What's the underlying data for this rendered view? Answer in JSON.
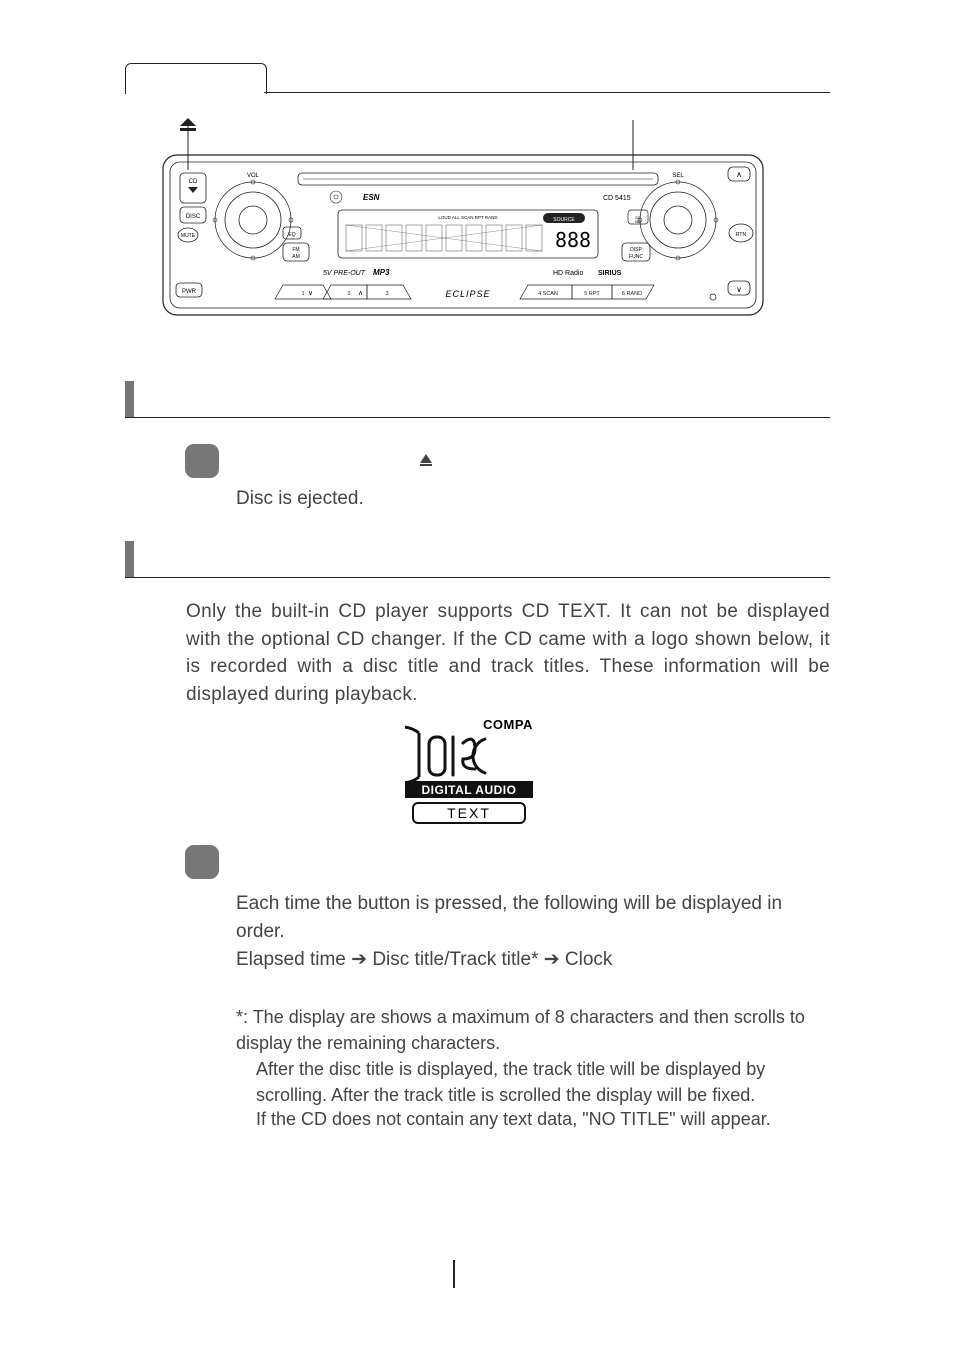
{
  "radio": {
    "model": "CD 5415",
    "brand": "ECLIPSE",
    "esn": "ESN",
    "labels": {
      "cd": "CD",
      "vol": "VOL",
      "sel": "SEL",
      "disc": "DISC",
      "mute": "MUTE",
      "sound": "SOUND",
      "rtn": "RTN",
      "fmam": "FM\nAM",
      "eq": "EQ",
      "disp_func": "DISP\nFUNC",
      "pwr": "PWR",
      "preout": "5V PRE-OUT",
      "mp3": "MP3",
      "hdradio": "HD Radio",
      "sirius": "SIRIUS",
      "seg": "888",
      "source": "SOURCE",
      "lcd_indic": "LOUD ALL SCAN RPT RAND"
    },
    "presets": [
      "1",
      "2",
      "3",
      "4  SCAN",
      "5  RPT",
      "6  RAND"
    ],
    "tune_down": "∨",
    "tune_up": "∧"
  },
  "section1": {
    "step": {
      "eject_icon": "eject",
      "result": "Disc is ejected."
    }
  },
  "section2": {
    "intro": "Only the built-in CD player supports CD TEXT. It can not be displayed with the optional CD changer. If the CD came with a logo shown below, it is recorded with a disc title and track titles. These information will be displayed during playback.",
    "cd_logo": {
      "line1": "COMPACT",
      "line2": "DIGITAL AUDIO",
      "line3": "TEXT"
    },
    "step": {
      "p1": "Each time the button is pressed, the following will be displayed in order.",
      "seq_a": "Elapsed time",
      "arrow": "➔",
      "seq_b": "Disc title/Track title*",
      "seq_c": "Clock",
      "note_lead": "*: ",
      "note1": "The display are shows a maximum of 8 characters and then scrolls to display the remaining characters.",
      "note2": "After the disc title is displayed, the track title will be displayed by scrolling. After the track title is scrolled the display will be fixed.",
      "note3": "If the CD does not contain any text data, \"NO TITLE\" will appear."
    }
  }
}
